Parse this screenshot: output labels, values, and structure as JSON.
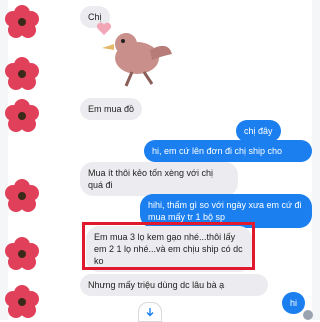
{
  "messages": [
    {
      "side": "in",
      "text": "Chị"
    },
    {
      "side": "in",
      "text": "Em mua đồ"
    },
    {
      "side": "out",
      "text": "chị đây"
    },
    {
      "side": "out",
      "text": "hi, em cứ lên đơn đi chị ship cho"
    },
    {
      "side": "in",
      "text": "Mua ít thôi kẻo tốn xèng với chị quá đi"
    },
    {
      "side": "out",
      "text": "hihi, thấm gì so với ngày xưa em cứ đi mua mấy tr 1 bộ sp"
    },
    {
      "side": "in",
      "text": "Em mua 3 lọ kem gạo nhé...thôi lấy em 2 1 lọ nhé...và em chịu ship có dc ko"
    },
    {
      "side": "in",
      "text": "Nhưng mấy triệu dùng dc lâu bà ạ"
    },
    {
      "side": "out",
      "text": "hi"
    }
  ],
  "colors": {
    "incoming_bubble": "#ececf0",
    "outgoing_bubble": "#1b7ff0",
    "highlight_border": "#e0192e",
    "avatar_flower": "#e0405a"
  },
  "icons": {
    "avatar": "pink-flower-avatar-icon",
    "sticker": "dancing-bird-sticker",
    "scroll": "arrow-down-icon"
  }
}
